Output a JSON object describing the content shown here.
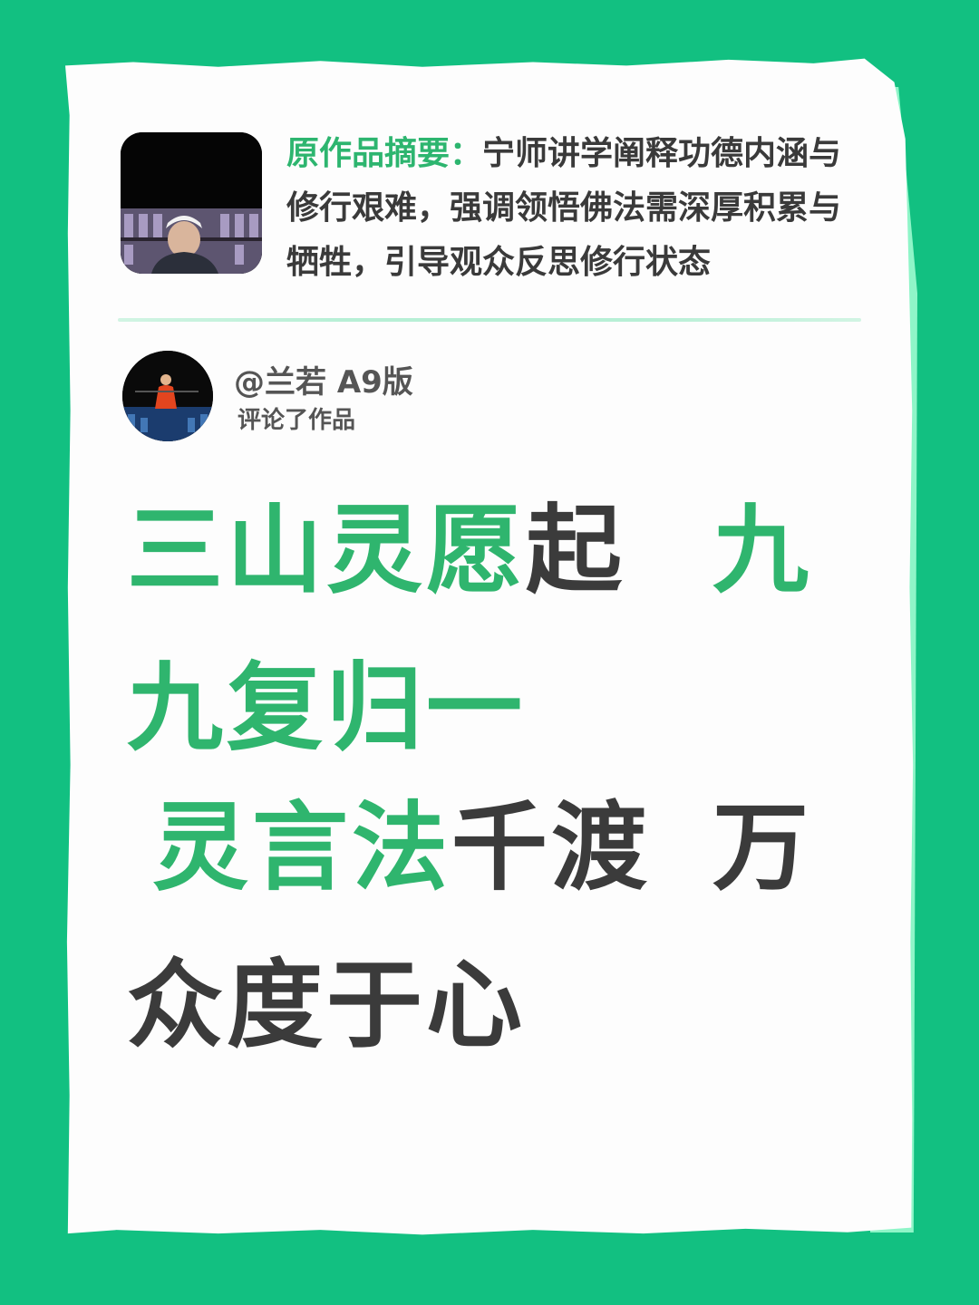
{
  "colors": {
    "background": "#12c081",
    "accent_green": "#2fb56e",
    "text_dark": "#3b3b3b"
  },
  "work": {
    "thumbnail_alt": "video-thumbnail",
    "summary_label": "原作品摘要：",
    "summary_text": "宁师讲学阐释功德内涵与修行艰难，强调领悟佛法需深厚积累与牺牲，引导观众反思修行状态"
  },
  "comment": {
    "username": "@兰若 A9版",
    "action": "评论了作品",
    "lines": [
      {
        "green": "三山灵愿",
        "dark": "起",
        "tail_green": "九"
      },
      {
        "green": "九复归一"
      },
      {
        "green": "灵言法",
        "dark": "千渡",
        "tail_dark": "万"
      },
      {
        "dark": "众度于心"
      }
    ]
  }
}
